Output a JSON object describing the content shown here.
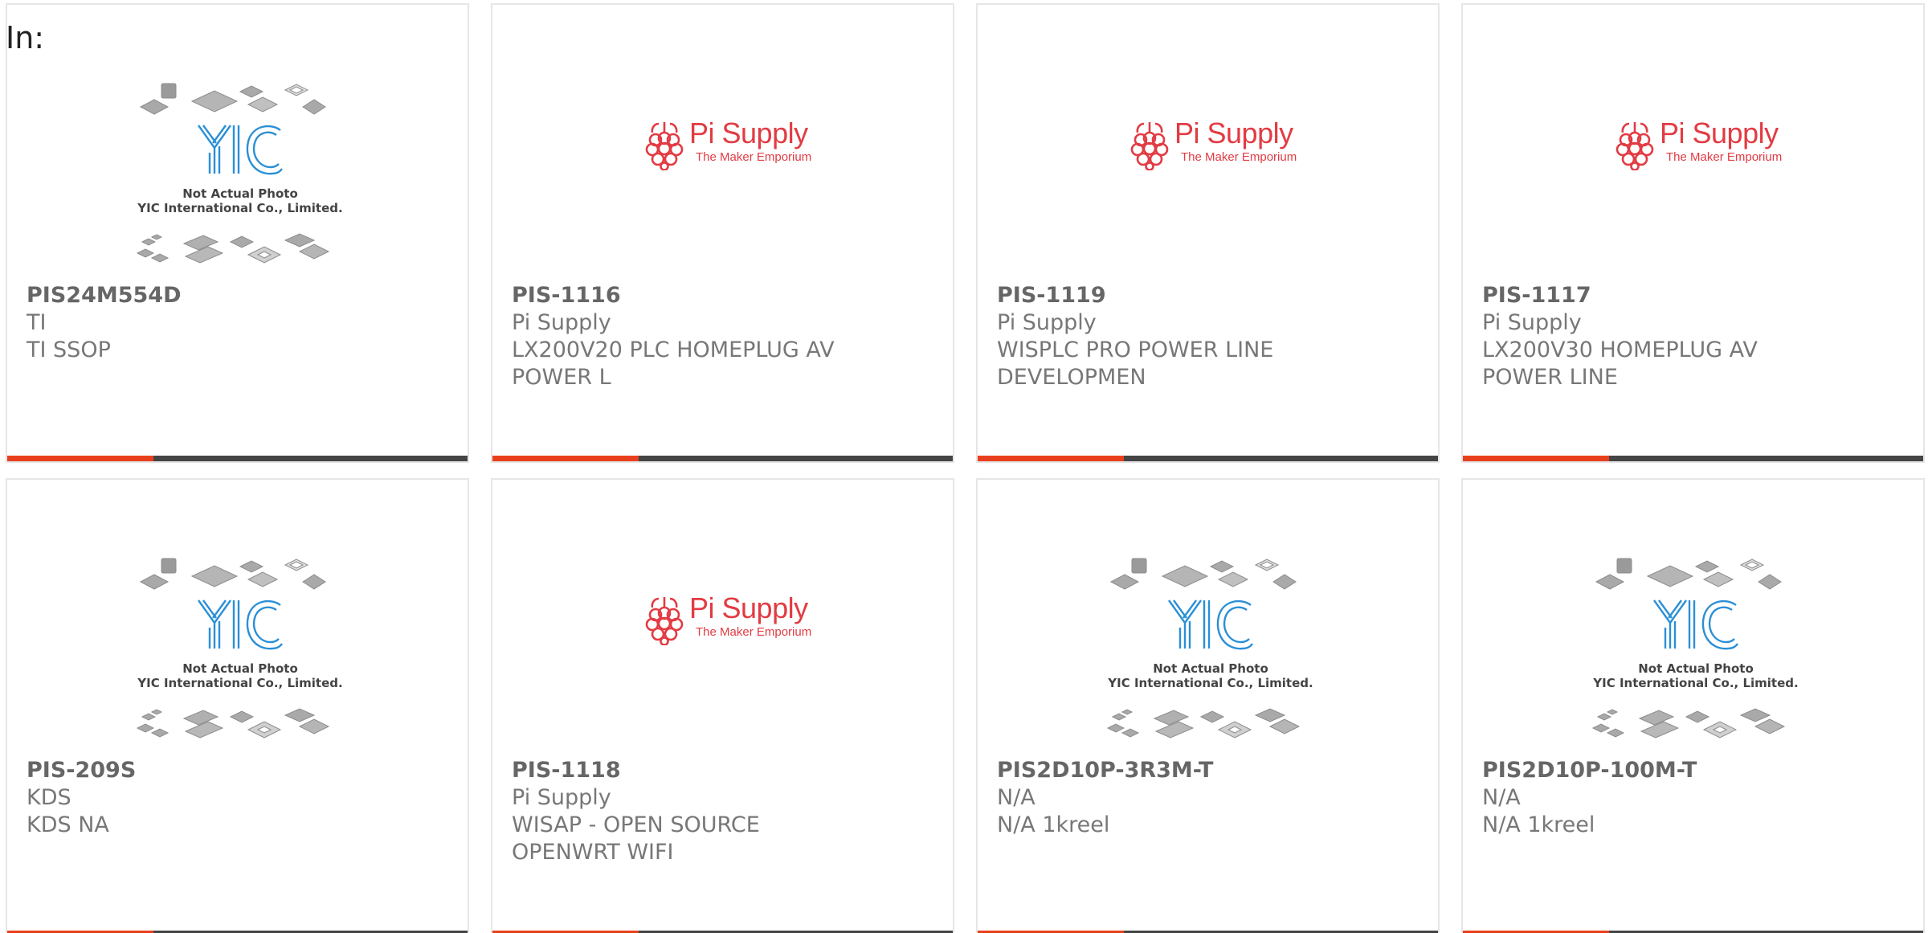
{
  "header": {
    "label": "In:"
  },
  "colors": {
    "accent": "#e8401c",
    "bar": "#444444",
    "pi_red": "#e23b43",
    "yic_blue": "#2a8fd6"
  },
  "placeholder": {
    "yic_line1": "Not Actual Photo",
    "yic_line2": "YIC International Co., Limited.",
    "yic_mark": "YIC",
    "pi_brand": "Pi Supply",
    "pi_tagline": "The Maker Emporium"
  },
  "products": [
    {
      "part": "PIS24M554D",
      "maker": "TI",
      "desc": "TI SSOP",
      "image": "yic"
    },
    {
      "part": "PIS-1116",
      "maker": "Pi Supply",
      "desc": "LX200V20 PLC HOMEPLUG AV POWER L",
      "image": "pi"
    },
    {
      "part": "PIS-1119",
      "maker": "Pi Supply",
      "desc": "WISPLC PRO POWER LINE DEVELOPMEN",
      "image": "pi"
    },
    {
      "part": "PIS-1117",
      "maker": "Pi Supply",
      "desc": "LX200V30 HOMEPLUG AV POWER LINE",
      "image": "pi"
    },
    {
      "part": "PIS-209S",
      "maker": "KDS",
      "desc": "KDS NA",
      "image": "yic"
    },
    {
      "part": "PIS-1118",
      "maker": "Pi Supply",
      "desc": "WISAP - OPEN SOURCE OPENWRT WIFI",
      "image": "pi"
    },
    {
      "part": "PIS2D10P-3R3M-T",
      "maker": "N/A",
      "desc": "N/A 1kreel",
      "image": "yic"
    },
    {
      "part": "PIS2D10P-100M-T",
      "maker": "N/A",
      "desc": "N/A 1kreel",
      "image": "yic"
    }
  ]
}
